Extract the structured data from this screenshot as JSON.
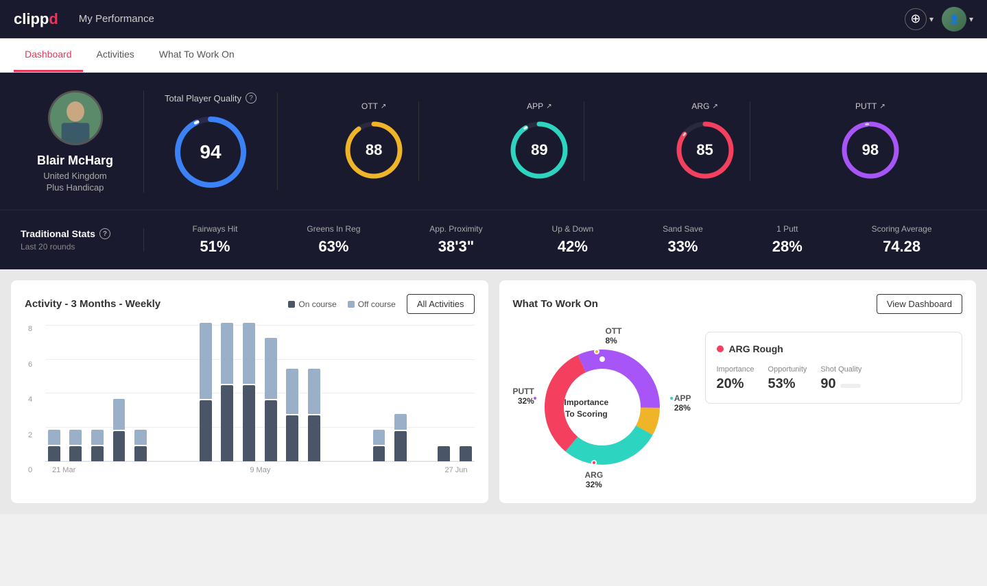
{
  "app": {
    "logo": "clippd",
    "header_title": "My Performance"
  },
  "nav": {
    "tabs": [
      {
        "label": "Dashboard",
        "active": true
      },
      {
        "label": "Activities",
        "active": false
      },
      {
        "label": "What To Work On",
        "active": false
      }
    ]
  },
  "player": {
    "name": "Blair McHarg",
    "country": "United Kingdom",
    "handicap": "Plus Handicap"
  },
  "scores": {
    "total_quality_label": "Total Player Quality",
    "total": 94,
    "categories": [
      {
        "label": "OTT",
        "value": 88,
        "color": "#f0b429",
        "trend": "↗"
      },
      {
        "label": "APP",
        "value": 89,
        "color": "#2dd4bf",
        "trend": "↗"
      },
      {
        "label": "ARG",
        "value": 85,
        "color": "#f43f5e",
        "trend": "↗"
      },
      {
        "label": "PUTT",
        "value": 98,
        "color": "#a855f7",
        "trend": "↗"
      }
    ]
  },
  "traditional_stats": {
    "title": "Traditional Stats",
    "subtitle": "Last 20 rounds",
    "stats": [
      {
        "label": "Fairways Hit",
        "value": "51%"
      },
      {
        "label": "Greens In Reg",
        "value": "63%"
      },
      {
        "label": "App. Proximity",
        "value": "38'3\""
      },
      {
        "label": "Up & Down",
        "value": "42%"
      },
      {
        "label": "Sand Save",
        "value": "33%"
      },
      {
        "label": "1 Putt",
        "value": "28%"
      },
      {
        "label": "Scoring Average",
        "value": "74.28"
      }
    ]
  },
  "activity_chart": {
    "title": "Activity - 3 Months - Weekly",
    "legend": {
      "on_course": "On course",
      "off_course": "Off course"
    },
    "all_activities_btn": "All Activities",
    "x_labels": [
      "21 Mar",
      "9 May",
      "27 Jun"
    ],
    "y_labels": [
      "8",
      "6",
      "4",
      "2",
      "0"
    ],
    "bars": [
      {
        "on": 1,
        "off": 1
      },
      {
        "on": 1,
        "off": 1
      },
      {
        "on": 1,
        "off": 1
      },
      {
        "on": 2,
        "off": 2
      },
      {
        "on": 1,
        "off": 1
      },
      {
        "on": 0,
        "off": 0
      },
      {
        "on": 0,
        "off": 0
      },
      {
        "on": 4,
        "off": 5
      },
      {
        "on": 5,
        "off": 4
      },
      {
        "on": 5,
        "off": 4
      },
      {
        "on": 4,
        "off": 4
      },
      {
        "on": 3,
        "off": 3
      },
      {
        "on": 3,
        "off": 3
      },
      {
        "on": 0,
        "off": 0
      },
      {
        "on": 0,
        "off": 0
      },
      {
        "on": 1,
        "off": 1
      },
      {
        "on": 2,
        "off": 1
      },
      {
        "on": 0,
        "off": 0
      },
      {
        "on": 1,
        "off": 0
      },
      {
        "on": 1,
        "off": 0
      }
    ]
  },
  "what_to_work_on": {
    "title": "What To Work On",
    "view_dashboard_btn": "View Dashboard",
    "donut_center": "Importance\nTo Scoring",
    "segments": [
      {
        "label": "OTT",
        "pct": "8%",
        "color": "#f0b429"
      },
      {
        "label": "APP",
        "pct": "28%",
        "color": "#2dd4bf"
      },
      {
        "label": "ARG",
        "pct": "32%",
        "color": "#f43f5e"
      },
      {
        "label": "PUTT",
        "pct": "32%",
        "color": "#a855f7"
      }
    ],
    "card": {
      "title": "ARG Rough",
      "dot_color": "#f43f5e",
      "metrics": [
        {
          "label": "Importance",
          "value": "20%"
        },
        {
          "label": "Opportunity",
          "value": "53%"
        },
        {
          "label": "Shot Quality",
          "value": "90"
        }
      ]
    }
  }
}
